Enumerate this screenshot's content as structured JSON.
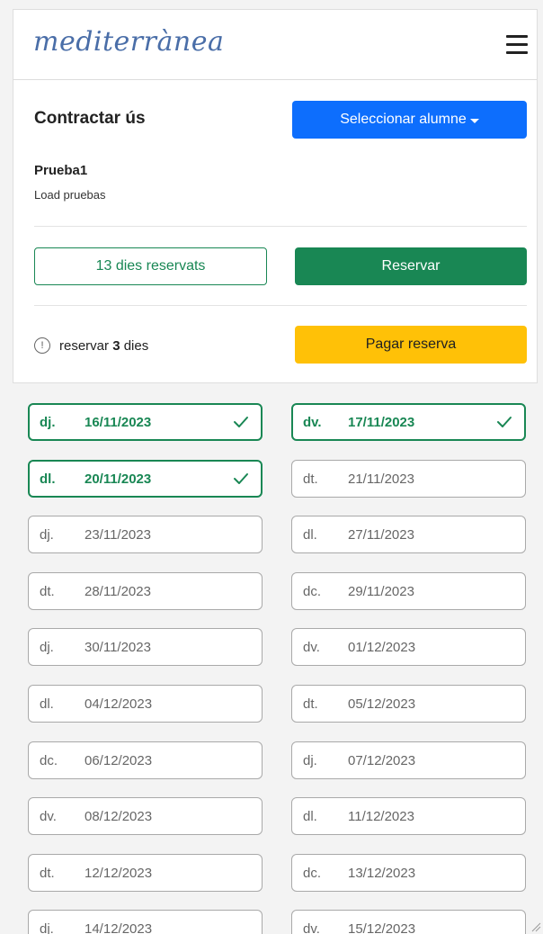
{
  "brand": {
    "logo_text": "mediterrànea"
  },
  "header": {
    "title": "Contractar ús",
    "select_button": "Seleccionar alumne"
  },
  "student": {
    "name": "Prueba1",
    "subtitle": "Load pruebas"
  },
  "actions": {
    "days_reserved": "13 dies reservats",
    "reserve_button": "Reservar",
    "pay_button": "Pagar reserva"
  },
  "info": {
    "prefix": "reservar",
    "count": "3",
    "suffix": "dies"
  },
  "colors": {
    "primary": "#0d6efd",
    "success": "#198754",
    "warning": "#ffc107"
  },
  "days": [
    {
      "dow": "dj.",
      "date": "16/11/2023",
      "selected": true
    },
    {
      "dow": "dv.",
      "date": "17/11/2023",
      "selected": true
    },
    {
      "dow": "dl.",
      "date": "20/11/2023",
      "selected": true
    },
    {
      "dow": "dt.",
      "date": "21/11/2023",
      "selected": false
    },
    {
      "dow": "dj.",
      "date": "23/11/2023",
      "selected": false
    },
    {
      "dow": "dl.",
      "date": "27/11/2023",
      "selected": false
    },
    {
      "dow": "dt.",
      "date": "28/11/2023",
      "selected": false
    },
    {
      "dow": "dc.",
      "date": "29/11/2023",
      "selected": false
    },
    {
      "dow": "dj.",
      "date": "30/11/2023",
      "selected": false
    },
    {
      "dow": "dv.",
      "date": "01/12/2023",
      "selected": false
    },
    {
      "dow": "dl.",
      "date": "04/12/2023",
      "selected": false
    },
    {
      "dow": "dt.",
      "date": "05/12/2023",
      "selected": false
    },
    {
      "dow": "dc.",
      "date": "06/12/2023",
      "selected": false
    },
    {
      "dow": "dj.",
      "date": "07/12/2023",
      "selected": false
    },
    {
      "dow": "dv.",
      "date": "08/12/2023",
      "selected": false
    },
    {
      "dow": "dl.",
      "date": "11/12/2023",
      "selected": false
    },
    {
      "dow": "dt.",
      "date": "12/12/2023",
      "selected": false
    },
    {
      "dow": "dc.",
      "date": "13/12/2023",
      "selected": false
    },
    {
      "dow": "dj.",
      "date": "14/12/2023",
      "selected": false
    },
    {
      "dow": "dv.",
      "date": "15/12/2023",
      "selected": false
    }
  ]
}
